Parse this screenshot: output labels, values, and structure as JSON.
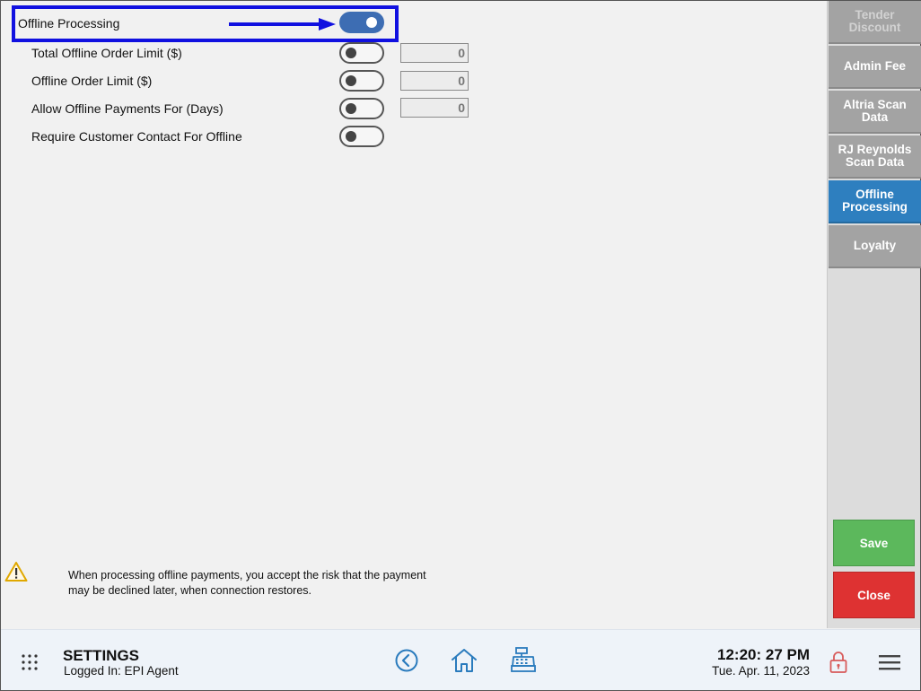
{
  "settings": {
    "offline_processing": {
      "label": "Offline Processing",
      "enabled": true
    },
    "rows": [
      {
        "label": "Total Offline Order Limit ($)",
        "value": "0"
      },
      {
        "label": "Offline Order Limit ($)",
        "value": "0"
      },
      {
        "label": "Allow Offline Payments For (Days)",
        "value": "0"
      },
      {
        "label": "Require Customer Contact For Offline"
      }
    ]
  },
  "warning": {
    "icon": "warning-icon",
    "text": "When processing offline payments, you accept the risk that the payment may be declined later, when connection restores."
  },
  "sidebar": {
    "items": [
      {
        "label": "Tender Discount",
        "state": "dim"
      },
      {
        "label": "Admin Fee",
        "state": "normal"
      },
      {
        "label": "Altria Scan Data",
        "state": "normal"
      },
      {
        "label": "RJ Reynolds Scan Data",
        "state": "normal"
      },
      {
        "label": "Offline Processing",
        "state": "active"
      },
      {
        "label": "Loyalty",
        "state": "normal"
      }
    ],
    "save_label": "Save",
    "close_label": "Close"
  },
  "footer": {
    "title": "SETTINGS",
    "logged_in": "Logged In:  EPI Agent",
    "time": "12:20: 27 PM",
    "date": "Tue. Apr. 11, 2023"
  },
  "colors": {
    "accent": "#3d6db3",
    "active_tab": "#2e7fbf",
    "save": "#5cb85c",
    "close": "#de3232",
    "highlight": "#1010e0"
  }
}
